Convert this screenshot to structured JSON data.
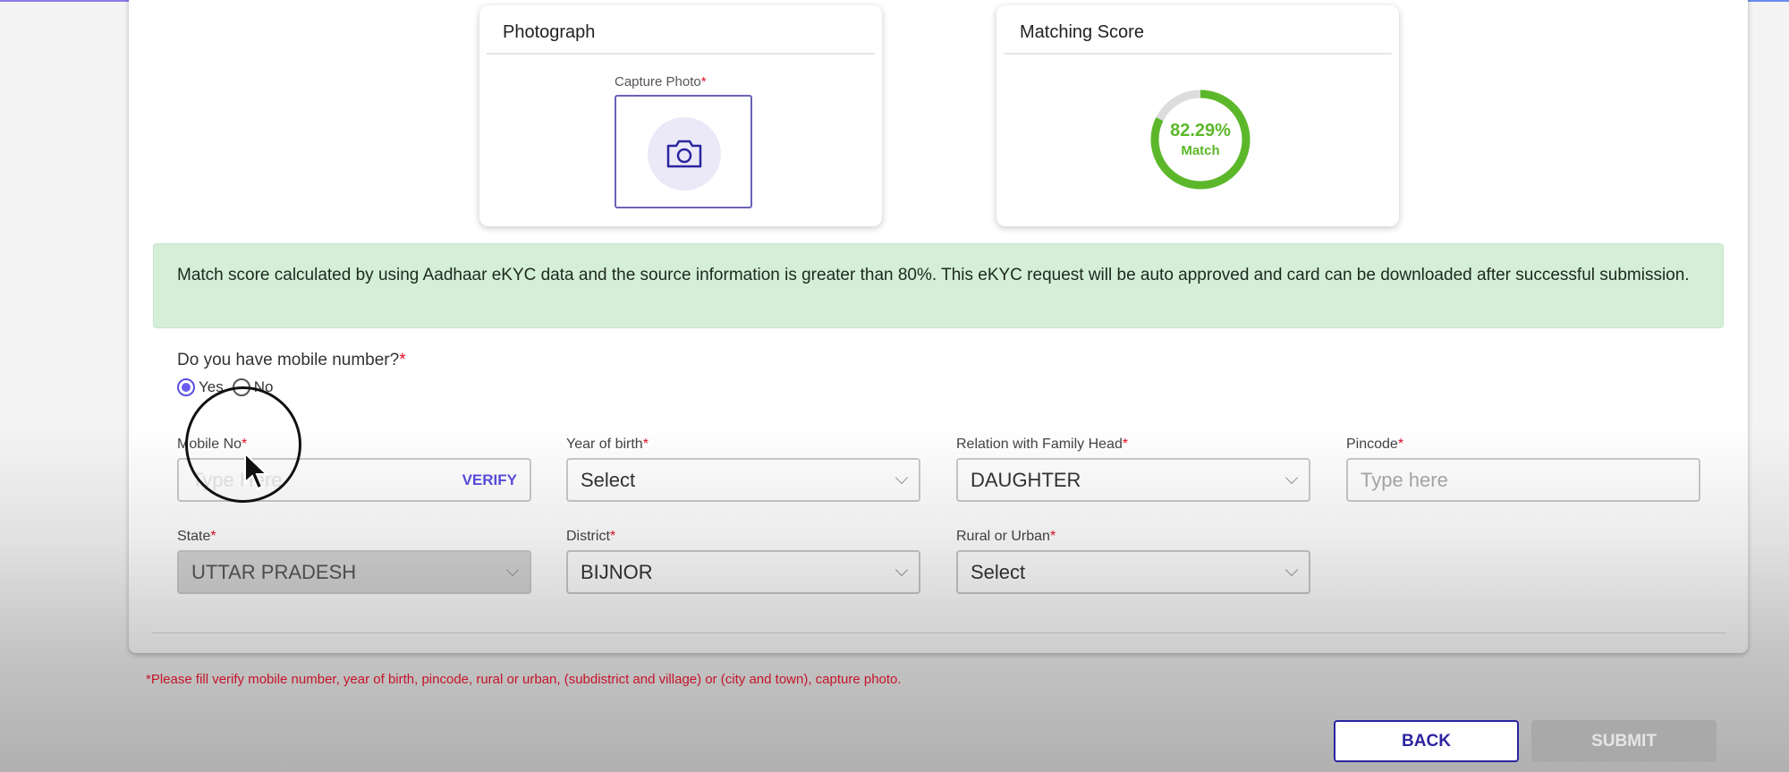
{
  "photograph": {
    "title": "Photograph",
    "capture_label": "Capture Photo",
    "required": "*"
  },
  "matching": {
    "title": "Matching Score",
    "percent_text": "82.29%",
    "percent": 82.29,
    "match_label": "Match",
    "color": "#5cb82a"
  },
  "banner": {
    "text": "Match score calculated by using Aadhaar eKYC data and the source information is greater than 80%. This eKYC request will be auto approved and card can be downloaded after successful submission."
  },
  "mobile_question": {
    "label": "Do you have mobile number?",
    "required": "*",
    "options": [
      "Yes",
      "No"
    ],
    "selected": "Yes"
  },
  "fields": {
    "mobile": {
      "label": "Mobile No",
      "placeholder": "Type Here",
      "verify": "VERIFY"
    },
    "year_of_birth": {
      "label": "Year of birth",
      "value": "Select"
    },
    "relation": {
      "label": "Relation with Family Head",
      "value": "DAUGHTER"
    },
    "pincode": {
      "label": "Pincode",
      "placeholder": "Type here"
    },
    "state": {
      "label": "State",
      "value": "UTTAR PRADESH"
    },
    "district": {
      "label": "District",
      "value": "BIJNOR"
    },
    "rural_urban": {
      "label": "Rural or Urban",
      "value": "Select"
    }
  },
  "error": "*Please fill verify mobile number, year of birth, pincode, rural or urban, (subdistrict and village) or (city and town), capture photo.",
  "buttons": {
    "back": "BACK",
    "submit": "SUBMIT"
  }
}
